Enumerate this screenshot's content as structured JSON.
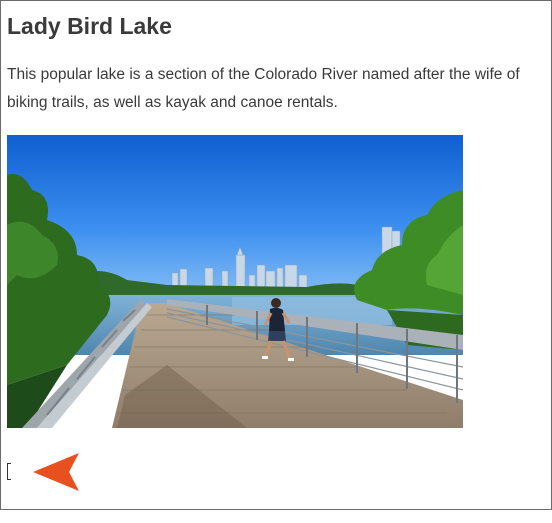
{
  "page": {
    "title": "Lady Bird Lake",
    "body_lines": [
      "This popular lake is a section of the Colorado River named after the wife of",
      "biking trails, as well as kayak and canoe rentals."
    ]
  },
  "photo": {
    "subject": "Runner on a boardwalk trail beside Lady Bird Lake with the Austin skyline in the background"
  },
  "colors": {
    "heading_text": "#3a3a3a",
    "pointer": "#e8511f",
    "sky": "#1f6fd6"
  },
  "icons": {
    "pointer": "arrow-pointer-icon"
  }
}
